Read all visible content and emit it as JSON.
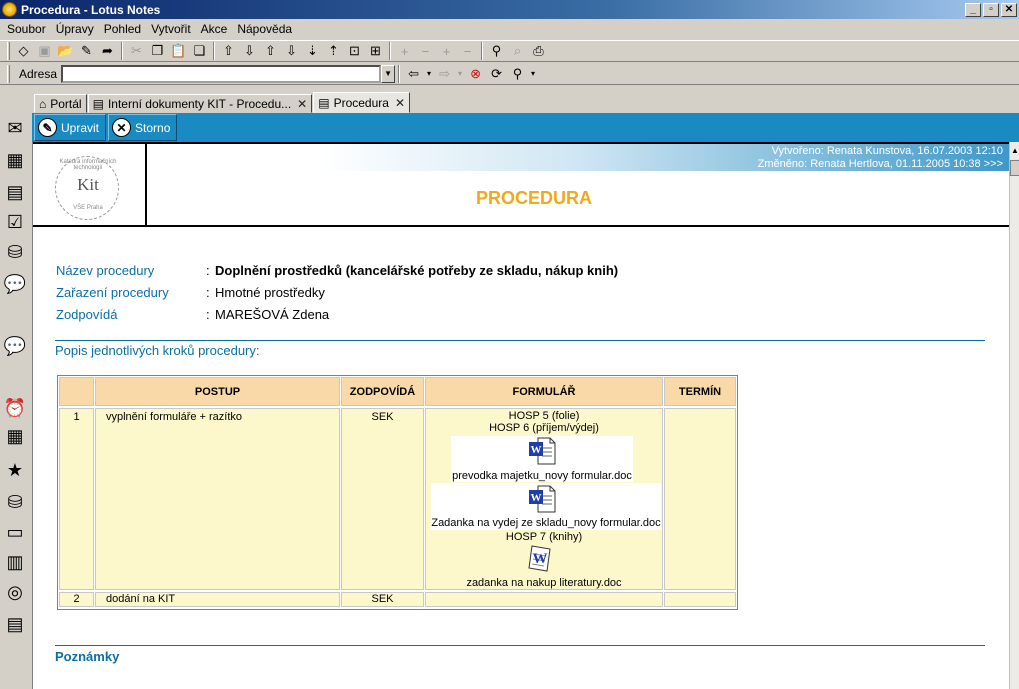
{
  "window": {
    "title": "Procedura - Lotus Notes",
    "buttons": [
      "_",
      "▫",
      "✕"
    ]
  },
  "menu": [
    "Soubor",
    "Úpravy",
    "Pohled",
    "Vytvořit",
    "Akce",
    "Nápověda"
  ],
  "address": {
    "label": "Adresa",
    "value": ""
  },
  "tabs": [
    {
      "label": "Portál",
      "closable": false
    },
    {
      "label": "Interní dokumenty KIT - Procedu...",
      "closable": true
    },
    {
      "label": "Procedura",
      "closable": true,
      "active": true
    }
  ],
  "actions": {
    "edit": "Upravit",
    "cancel": "Storno"
  },
  "header": {
    "created": "Vytvořeno: Renata Kunstova, 16.07.2003 12:10",
    "modified": "Změněno: Renata Hertlova, 01.11.2005 10:38 >>>",
    "title": "PROCEDURA",
    "logo": {
      "main": "Kit",
      "ring_top": "Katedra informačních technologií",
      "ring_bottom": "VŠE Praha"
    }
  },
  "fields": [
    {
      "label": "Název procedury",
      "value": "Doplnění prostředků (kancelářské potřeby ze skladu, nákup knih)"
    },
    {
      "label": "Zařazení procedury",
      "value": "Hmotné prostředky"
    },
    {
      "label": "Zodpovídá",
      "value": "MAREŠOVÁ Zdena"
    }
  ],
  "colon": ":",
  "steps_title": "Popis jednotlivých kroků procedury:",
  "table": {
    "headers": [
      "POSTUP",
      "ZODPOVÍDÁ",
      "FORMULÁŘ",
      "TERMÍN"
    ],
    "rows": [
      {
        "num": "1",
        "step": "vyplnění formuláře + razítko",
        "resp": "SEK",
        "form_lines": [
          "HOSP 5 (folie)",
          "HOSP 6 (příjem/výdej)"
        ],
        "attachments": [
          "prevodka majetku_novy formular.doc",
          "Zadanka na vydej ze skladu_novy formular.doc"
        ],
        "form_line_after": "HOSP 7 (knihy)",
        "attachment_last": "zadanka na nakup literatury.doc",
        "term": ""
      },
      {
        "num": "2",
        "step": "dodání na KIT",
        "resp": "SEK",
        "term": ""
      }
    ]
  },
  "notes_title": "Poznámky"
}
